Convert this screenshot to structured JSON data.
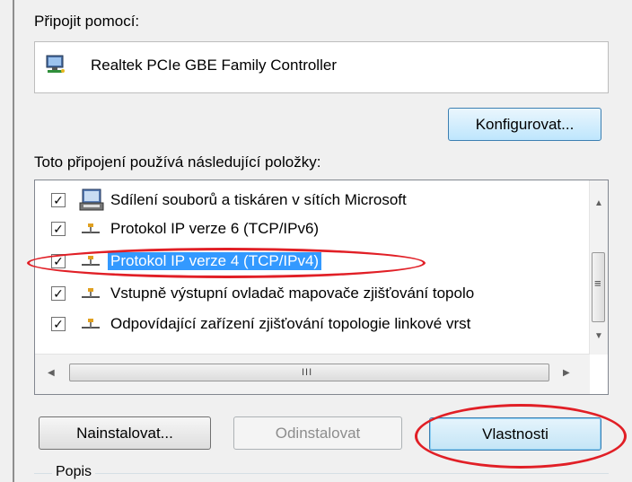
{
  "connect_label": "Připojit pomocí:",
  "adapter": {
    "name": "Realtek PCIe GBE Family Controller",
    "icon": "network-adapter-icon"
  },
  "configure_button": "Konfigurovat...",
  "items_label": "Toto připojení používá následující položky:",
  "items": [
    {
      "label": "Sdílení souborů a tiskáren v sítích Microsoft",
      "checked": true,
      "icon": "file-printer-sharing-icon"
    },
    {
      "label": "Protokol IP verze 6 (TCP/IPv6)",
      "checked": true,
      "icon": "network-protocol-icon"
    },
    {
      "label": "Protokol IP verze 4 (TCP/IPv4)",
      "checked": true,
      "icon": "network-protocol-icon",
      "selected": true
    },
    {
      "label": "Vstupně výstupní ovladač mapovače zjišťování topolo",
      "checked": true,
      "icon": "network-protocol-icon"
    },
    {
      "label": "Odpovídající zařízení zjišťování topologie linkové vrst",
      "checked": true,
      "icon": "network-protocol-icon"
    }
  ],
  "buttons": {
    "install": "Nainstalovat...",
    "uninstall": "Odinstalovat",
    "properties": "Vlastnosti"
  },
  "description_group": "Popis",
  "scrollbar_grip": "III",
  "highlight_color": "#e11f26",
  "selection_color": "#3399ff"
}
